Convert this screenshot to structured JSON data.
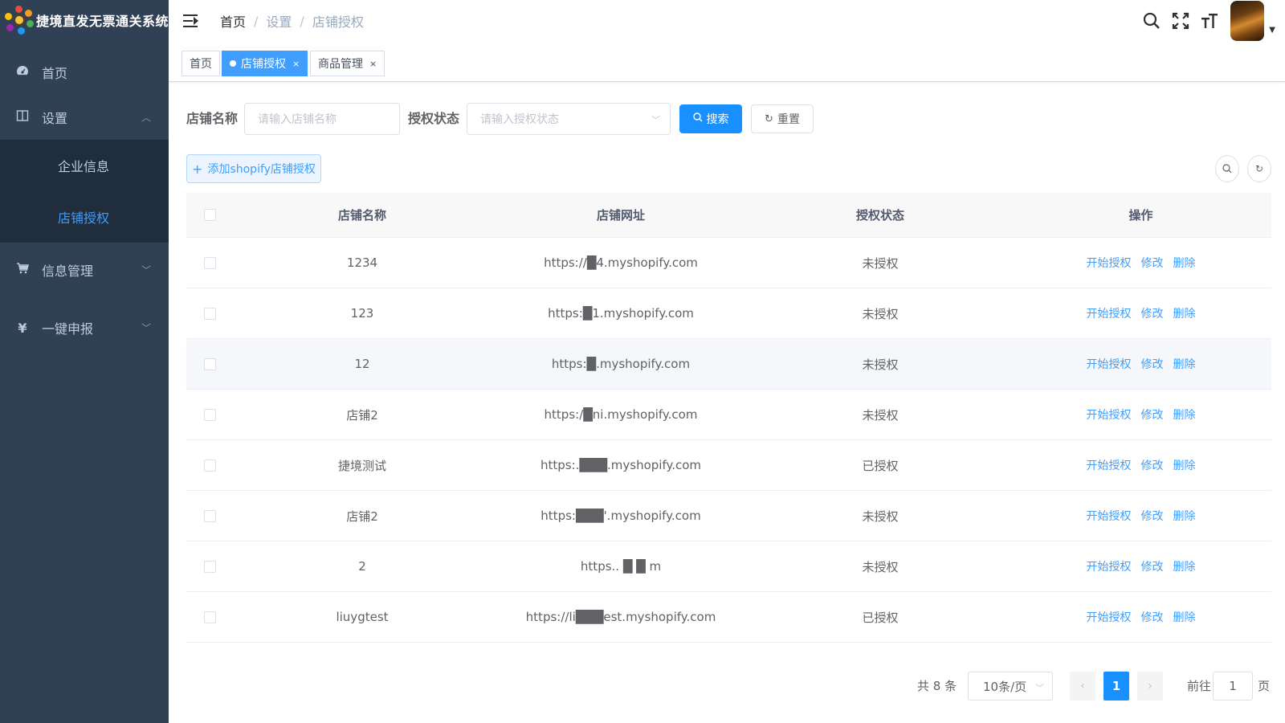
{
  "app": {
    "title": "捷境直发无票通关系统"
  },
  "sidebar": {
    "items": [
      {
        "label": "首页",
        "icon": "dashboard-icon"
      },
      {
        "label": "设置",
        "icon": "book-icon",
        "expanded": true
      },
      {
        "label": "信息管理",
        "icon": "cart-icon"
      },
      {
        "label": "一键申报",
        "icon": "yen-icon"
      }
    ],
    "settings_children": [
      {
        "label": "企业信息",
        "active": false
      },
      {
        "label": "店铺授权",
        "active": true
      }
    ]
  },
  "header": {
    "breadcrumb": [
      "首页",
      "设置",
      "店铺授权"
    ],
    "separator": "/"
  },
  "tags": [
    {
      "label": "首页",
      "active": false,
      "closable": false
    },
    {
      "label": "店铺授权",
      "active": true,
      "closable": true
    },
    {
      "label": "商品管理",
      "active": false,
      "closable": true
    }
  ],
  "tag_close_glyph": "×",
  "search": {
    "shop_name_label": "店铺名称",
    "shop_name_placeholder": "请输入店铺名称",
    "status_label": "授权状态",
    "status_placeholder": "请输入授权状态",
    "search_button": "搜索",
    "reset_button": "重置"
  },
  "toolbar": {
    "add_button": "添加shopify店铺授权"
  },
  "table": {
    "columns": [
      "店铺名称",
      "店铺网址",
      "授权状态",
      "操作"
    ],
    "rows": [
      {
        "name": "1234",
        "url": "https://█4.myshopify.com",
        "status": "未授权"
      },
      {
        "name": "123",
        "url": "https:█1.myshopify.com",
        "status": "未授权"
      },
      {
        "name": "12",
        "url": "https:█.myshopify.com",
        "status": "未授权"
      },
      {
        "name": "店铺2",
        "url": "https:/█ni.myshopify.com",
        "status": "未授权"
      },
      {
        "name": "捷境测试",
        "url": "https:.███.myshopify.com",
        "status": "已授权"
      },
      {
        "name": "店铺2",
        "url": "https:███'.myshopify.com",
        "status": "未授权"
      },
      {
        "name": "2",
        "url": "https.. █ █ m",
        "status": "未授权"
      },
      {
        "name": "liuygtest",
        "url": "https://li███est.myshopify.com",
        "status": "已授权"
      }
    ],
    "actions": [
      "开始授权",
      "修改",
      "删除"
    ],
    "hover_row_index": 2
  },
  "pagination": {
    "total": "共 8 条",
    "page_size": "10条/页",
    "current_page": "1",
    "goto_prefix": "前往",
    "goto_value": "1",
    "goto_suffix": "页"
  },
  "colors": {
    "sidebar_bg": "#304156",
    "sidebar_active": "#409eff",
    "primary": "#1890ff",
    "link": "#409eff"
  }
}
